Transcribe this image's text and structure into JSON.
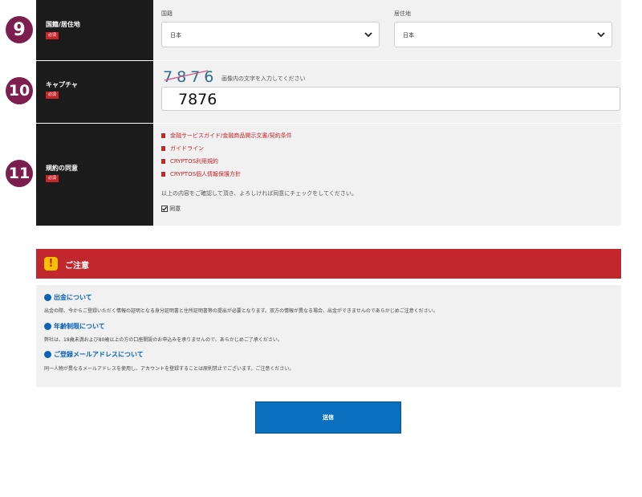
{
  "rows": {
    "nationality": {
      "step": "9",
      "label": "国籍/居住地",
      "required": "必須",
      "nationality_label": "国籍",
      "residence_label": "居住地",
      "nationality_value": "日本",
      "residence_value": "日本"
    },
    "captcha": {
      "step": "10",
      "label": "キャプチャ",
      "required": "必須",
      "image_text": "7876",
      "instruction": "画像内の文字を入力してください",
      "input_value": "7876"
    },
    "agreement": {
      "step": "11",
      "label": "規約の同意",
      "required": "必須",
      "links": [
        "金融サービスガイド/金融商品開示文書/契約条件",
        "ガイドライン",
        "CRYPTOS利用規約",
        "CRYPTOS個人情報保護方針"
      ],
      "instruction": "以上の内容をご確認して頂き、よろしければ同意にチェックをしてください。",
      "checkbox_label": "同意",
      "checked": true
    }
  },
  "notice": {
    "title": "ご注意",
    "icon": "!",
    "sections": [
      {
        "heading": "出金について",
        "text": "出金の際、今からご登録いただく情報の証明となる身分証明書と住所証明書等の提出が必要となります。双方の情報が異なる場合、出金ができませんのであらかじめご注意ください。"
      },
      {
        "heading": "年齢制限について",
        "text": "弊社は、18歳未満および80歳以上の方の口座開設のお申込みを承りませんので、あらかじめご了承ください。"
      },
      {
        "heading": "ご登録メールアドレスについて",
        "text": "同一人物が異なるメールアドレスを使用し、アカウントを登録することは原則禁止でございます。ご注意ください。"
      }
    ]
  },
  "submit_label": "送信",
  "colors": {
    "step_badge": "#7c1f4f",
    "label_bg": "#1b1b1b",
    "required_badge": "#c8242b",
    "notice_header": "#c1272d",
    "notice_heading": "#0a63b6",
    "submit_button": "#0b6fbf"
  }
}
